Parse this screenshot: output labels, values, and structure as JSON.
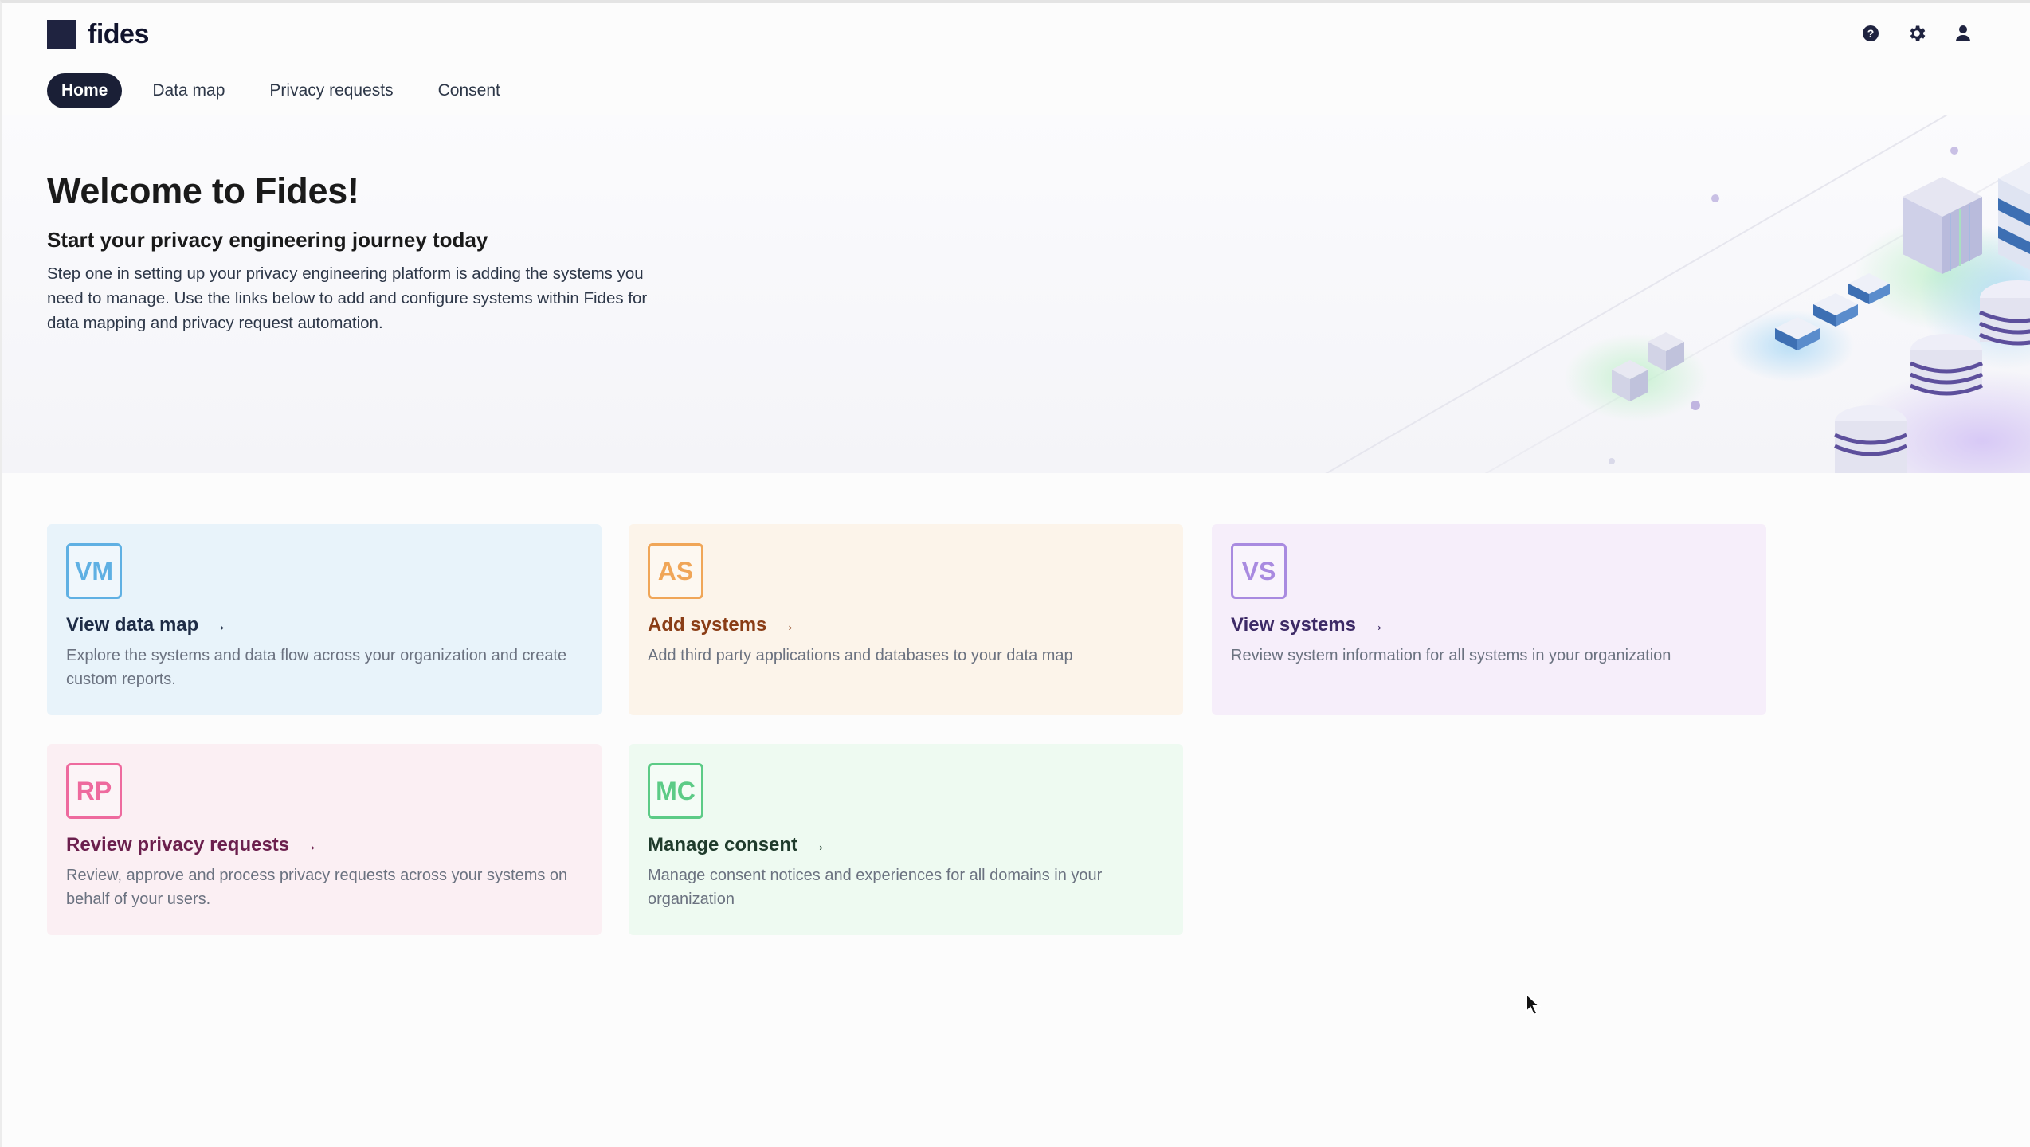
{
  "brand": {
    "name": "fides",
    "color": "#1f2340"
  },
  "header_icons": [
    "help-icon",
    "settings-gear-icon",
    "user-icon"
  ],
  "nav": {
    "items": [
      {
        "label": "Home",
        "active": true
      },
      {
        "label": "Data map",
        "active": false
      },
      {
        "label": "Privacy requests",
        "active": false
      },
      {
        "label": "Consent",
        "active": false
      }
    ]
  },
  "hero": {
    "title": "Welcome to Fides!",
    "subtitle": "Start your privacy engineering journey today",
    "description": "Step one in setting up your privacy engineering platform is adding the systems you need to manage. Use the links below to add and configure systems within Fides for data mapping and privacy request automation."
  },
  "cards": [
    {
      "badge": "VM",
      "title": "View data map",
      "description": "Explore the systems and data flow across your organization and create custom reports.",
      "accent": "#5fb0e3"
    },
    {
      "badge": "AS",
      "title": "Add systems",
      "description": "Add third party applications and databases to your data map",
      "accent": "#f0a658"
    },
    {
      "badge": "VS",
      "title": "View systems",
      "description": "Review system information for all systems in your organization",
      "accent": "#a98ae0"
    },
    {
      "badge": "RP",
      "title": "Review privacy requests",
      "description": "Review, approve and process privacy requests across your systems on behalf of your users.",
      "accent": "#ee6a9e"
    },
    {
      "badge": "MC",
      "title": "Manage consent",
      "description": "Manage consent notices and experiences for all domains in your organization",
      "accent": "#5ccb86"
    }
  ],
  "arrow_glyph": "→"
}
